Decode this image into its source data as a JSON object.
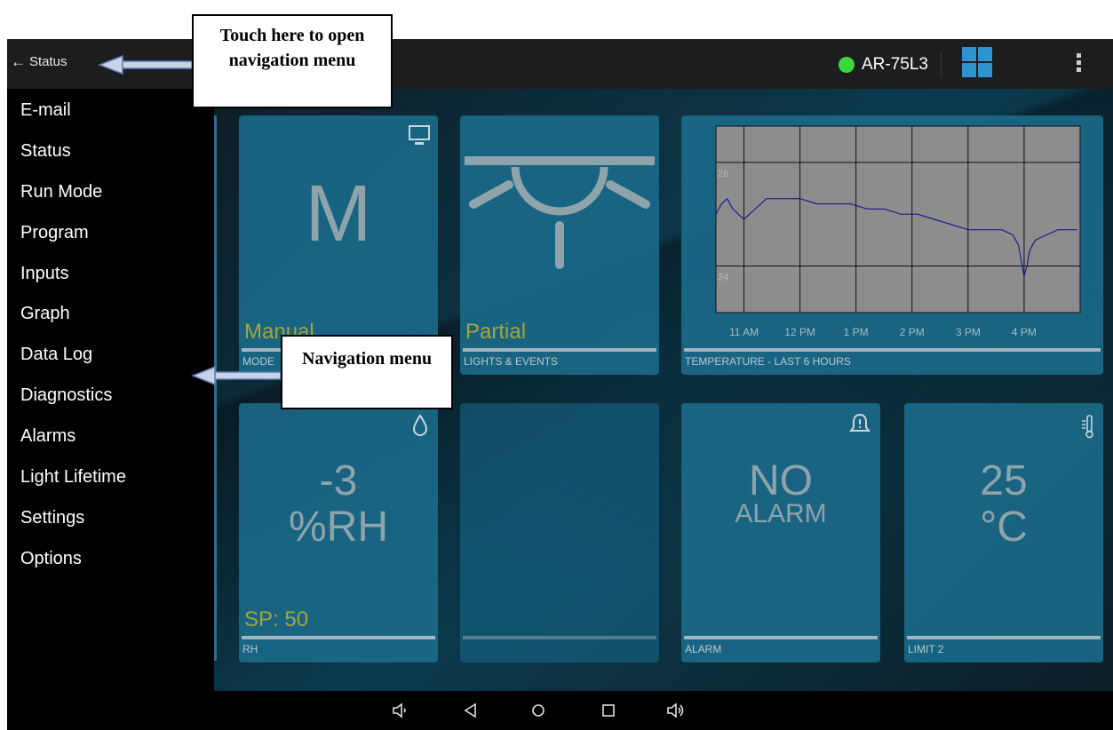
{
  "appbar": {
    "back_label": "Status",
    "device_name": "AR-75L3",
    "status_color": "#39d93d"
  },
  "nav_menu": {
    "items": [
      "E-mail",
      "Status",
      "Run Mode",
      "Program",
      "Inputs",
      "Graph",
      "Data Log",
      "Diagnostics",
      "Alarms",
      "Light Lifetime",
      "Settings",
      "Options"
    ]
  },
  "tiles": {
    "mode": {
      "value": "M",
      "status": "Manual",
      "caption": "MODE",
      "icon": "monitor-icon"
    },
    "lights": {
      "status": "Partial",
      "caption": "LIGHTS & EVENTS",
      "icon": "lamp-icon"
    },
    "temp_graph": {
      "caption": "TEMPERATURE - LAST 6 HOURS"
    },
    "rh": {
      "value": "-3",
      "unit": "%RH",
      "setpoint": "SP: 50",
      "caption": "RH",
      "icon": "droplet-icon"
    },
    "alarm": {
      "line1": "NO",
      "line2": "ALARM",
      "caption": "ALARM",
      "icon": "bell-icon"
    },
    "limit": {
      "value": "25",
      "unit": "°C",
      "caption": "LIMIT 2",
      "icon": "thermometer-icon"
    }
  },
  "callouts": {
    "top": "Touch here to open navigation menu",
    "middle": "Navigation menu"
  },
  "system_nav": {
    "icons": [
      "volume-down-icon",
      "back-icon",
      "home-icon",
      "recents-icon",
      "volume-up-icon"
    ]
  },
  "chart_data": {
    "type": "line",
    "title": "",
    "xlabel": "",
    "ylabel": "",
    "x_tick_labels": [
      "11 AM",
      "12 PM",
      "1 PM",
      "2 PM",
      "3 PM",
      "4 PM"
    ],
    "y_ticks": [
      24,
      26
    ],
    "ylim": [
      23.1,
      26.7
    ],
    "grid": true,
    "series": [
      {
        "color": "#1b1b8a",
        "x_hours": [
          10.5,
          10.6,
          10.7,
          10.8,
          10.9,
          11.0,
          11.2,
          11.4,
          11.6,
          11.8,
          12.0,
          12.3,
          12.6,
          12.9,
          13.2,
          13.5,
          13.8,
          14.1,
          14.4,
          14.7,
          15.0,
          15.3,
          15.6,
          15.8,
          15.9,
          16.0,
          16.05,
          16.1,
          16.2,
          16.4,
          16.6,
          16.8,
          16.95
        ],
        "values": [
          25.0,
          25.2,
          25.3,
          25.1,
          25.0,
          24.9,
          25.1,
          25.3,
          25.3,
          25.3,
          25.3,
          25.2,
          25.2,
          25.2,
          25.1,
          25.1,
          25.0,
          25.0,
          24.9,
          24.8,
          24.7,
          24.7,
          24.7,
          24.6,
          24.4,
          23.8,
          24.0,
          24.3,
          24.5,
          24.6,
          24.7,
          24.7,
          24.7
        ]
      }
    ]
  }
}
